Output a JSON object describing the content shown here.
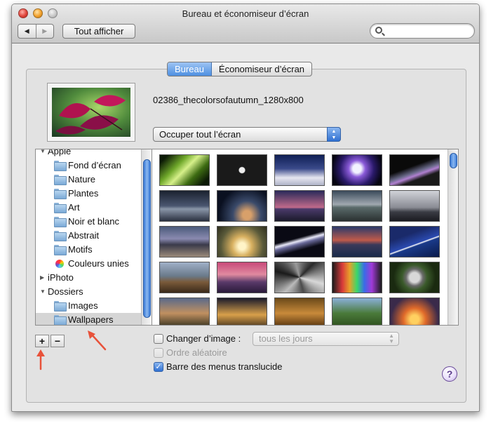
{
  "window": {
    "title": "Bureau et économiseur d’écran"
  },
  "toolbar": {
    "back_label": "◀",
    "forward_label": "▶",
    "show_all_label": "Tout afficher",
    "search_value": ""
  },
  "tabs": [
    {
      "label": "Bureau",
      "active": true
    },
    {
      "label": "Économiseur d’écran",
      "active": false
    }
  ],
  "desktop": {
    "filename": "02386_thecolorsofautumn_1280x800",
    "fit_option": "Occuper tout l’écran"
  },
  "sidebar": {
    "items": [
      {
        "label": "Apple",
        "kind": "group",
        "expanded": true,
        "icon": "disclosure-open-icon"
      },
      {
        "label": "Fond d’écran",
        "kind": "folder",
        "icon": "folder-icon"
      },
      {
        "label": "Nature",
        "kind": "folder",
        "icon": "folder-icon"
      },
      {
        "label": "Plantes",
        "kind": "folder",
        "icon": "folder-icon"
      },
      {
        "label": "Art",
        "kind": "folder",
        "icon": "folder-icon"
      },
      {
        "label": "Noir et blanc",
        "kind": "folder",
        "icon": "folder-icon"
      },
      {
        "label": "Abstrait",
        "kind": "folder",
        "icon": "folder-icon"
      },
      {
        "label": "Motifs",
        "kind": "folder",
        "icon": "folder-icon"
      },
      {
        "label": "Couleurs unies",
        "kind": "swatch",
        "icon": "color-wheel-icon"
      },
      {
        "label": "iPhoto",
        "kind": "group",
        "expanded": false,
        "icon": "disclosure-closed-icon"
      },
      {
        "label": "Dossiers",
        "kind": "group",
        "expanded": true,
        "icon": "disclosure-open-icon"
      },
      {
        "label": "Images",
        "kind": "folder",
        "icon": "pictures-folder-icon"
      },
      {
        "label": "Wallpapers",
        "kind": "folder",
        "icon": "folder-icon",
        "selected": true
      }
    ]
  },
  "list_buttons": {
    "add_label": "+",
    "remove_label": "−"
  },
  "options": {
    "change_picture_label": "Changer d’image :",
    "change_picture_checked": false,
    "interval_value": "tous les jours",
    "random_order_label": "Ordre aléatoire",
    "random_order_checked": false,
    "translucent_menu_label": "Barre des menus translucide",
    "translucent_menu_checked": true
  },
  "help_label": "?",
  "colors": {
    "accent": "#3b7bd8",
    "annotation_arrow": "#e8523a"
  }
}
